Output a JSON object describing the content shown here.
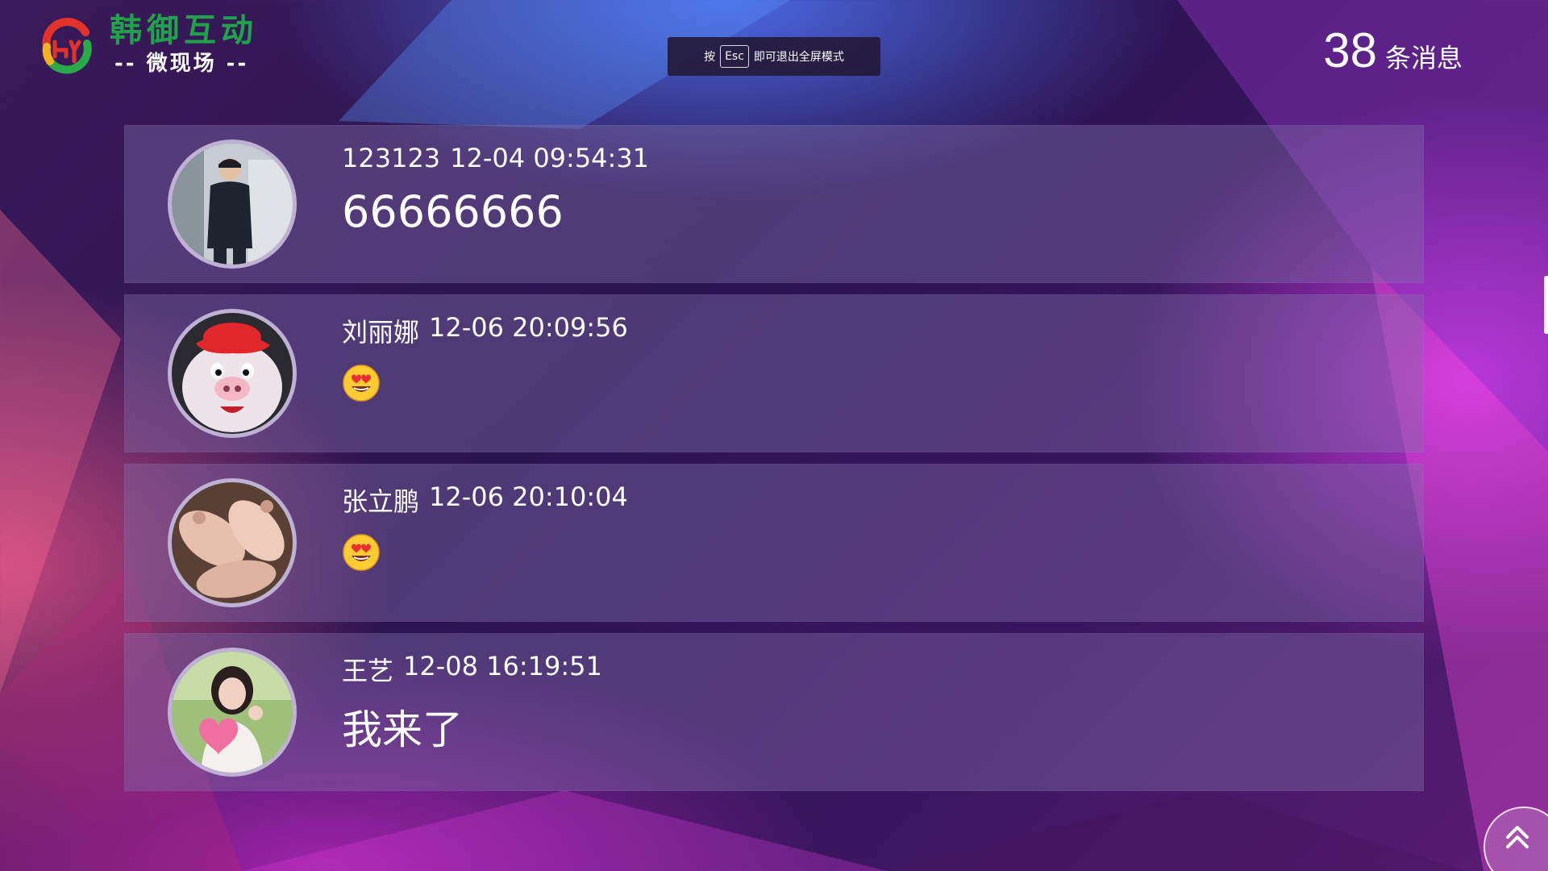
{
  "header": {
    "logo_title": "韩御互动",
    "logo_subtitle": "-- 微现场 --",
    "esc_hint_before": "按",
    "esc_key": "Esc",
    "esc_hint_after": "即可退出全屏模式",
    "message_count": "38",
    "message_count_unit": "条消息"
  },
  "messages": [
    {
      "name": "123123",
      "time": "12-04 09:54:31",
      "type": "text",
      "content": "66666666",
      "avatar": "young-man-avatar"
    },
    {
      "name": "刘丽娜",
      "time": "12-06 20:09:56",
      "type": "emoji",
      "content": "heart-eyes-emoji",
      "avatar": "pig-mascot-avatar"
    },
    {
      "name": "张立鹏",
      "time": "12-06 20:10:04",
      "type": "emoji",
      "content": "heart-eyes-emoji",
      "avatar": "piglets-avatar"
    },
    {
      "name": "王艺",
      "time": "12-08 16:19:51",
      "type": "text",
      "content": "我来了",
      "avatar": "girl-heart-avatar"
    }
  ],
  "icons": {
    "logo": "hy-logo-icon",
    "scroll_top": "double-chevron-up-icon"
  },
  "colors": {
    "logo_green": "#1fa24a",
    "logo_red": "#e2332a",
    "card_bg": "rgba(128,110,170,0.42)"
  }
}
